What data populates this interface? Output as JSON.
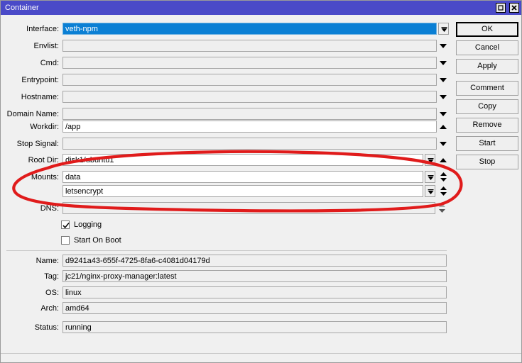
{
  "window": {
    "title": "Container",
    "titlebar_color": "#4a4ac8",
    "buttons": {
      "maximize": "maximize-restore",
      "close": "close"
    }
  },
  "form": {
    "fields": [
      {
        "label": "Interface:",
        "value": "veth-npm",
        "name": "interface",
        "selected": true
      },
      {
        "label": "Envlist:",
        "value": "",
        "name": "envlist"
      },
      {
        "label": "Cmd:",
        "value": "",
        "name": "cmd"
      },
      {
        "label": "Entrypoint:",
        "value": "",
        "name": "entrypoint"
      },
      {
        "label": "Hostname:",
        "value": "",
        "name": "hostname"
      },
      {
        "label": "Domain Name:",
        "value": "",
        "name": "domain-name"
      },
      {
        "label": "Workdir:",
        "value": "/app",
        "name": "workdir"
      },
      {
        "label": "Stop Signal:",
        "value": "",
        "name": "stop-signal"
      },
      {
        "label": "Root Dir:",
        "value": "disk1/ubuntu1",
        "name": "root-dir"
      },
      {
        "label": "Mounts:",
        "value": "data",
        "name": "mounts-1"
      },
      {
        "label": "",
        "value": "letsencrypt",
        "name": "mounts-2"
      },
      {
        "label": "DNS:",
        "value": "",
        "name": "dns"
      }
    ]
  },
  "checkboxes": [
    {
      "label": "Logging",
      "checked": true,
      "name": "logging"
    },
    {
      "label": "Start On Boot",
      "checked": false,
      "name": "start-on-boot"
    }
  ],
  "info": {
    "rows": [
      {
        "label": "Name:",
        "value": "d9241a43-655f-4725-8fa6-c4081d04179d",
        "name": "name"
      },
      {
        "label": "Tag:",
        "value": "jc21/nginx-proxy-manager:latest",
        "name": "tag"
      },
      {
        "label": "OS:",
        "value": "linux",
        "name": "os"
      },
      {
        "label": "Arch:",
        "value": "amd64",
        "name": "arch"
      },
      {
        "label": "Status:",
        "value": "running",
        "name": "status"
      }
    ]
  },
  "actions": {
    "buttons": [
      {
        "label": "OK",
        "name": "ok",
        "default": true
      },
      {
        "label": "Cancel",
        "name": "cancel"
      },
      {
        "label": "Apply",
        "name": "apply"
      },
      {
        "label": "Comment",
        "name": "comment"
      },
      {
        "label": "Copy",
        "name": "copy"
      },
      {
        "label": "Remove",
        "name": "remove"
      },
      {
        "label": "Start",
        "name": "start"
      },
      {
        "label": "Stop",
        "name": "stop"
      }
    ]
  },
  "annotation": {
    "shape": "ellipse",
    "color": "#e01b1b",
    "description": "red hand-drawn ellipse around Root Dir and Mounts rows"
  }
}
